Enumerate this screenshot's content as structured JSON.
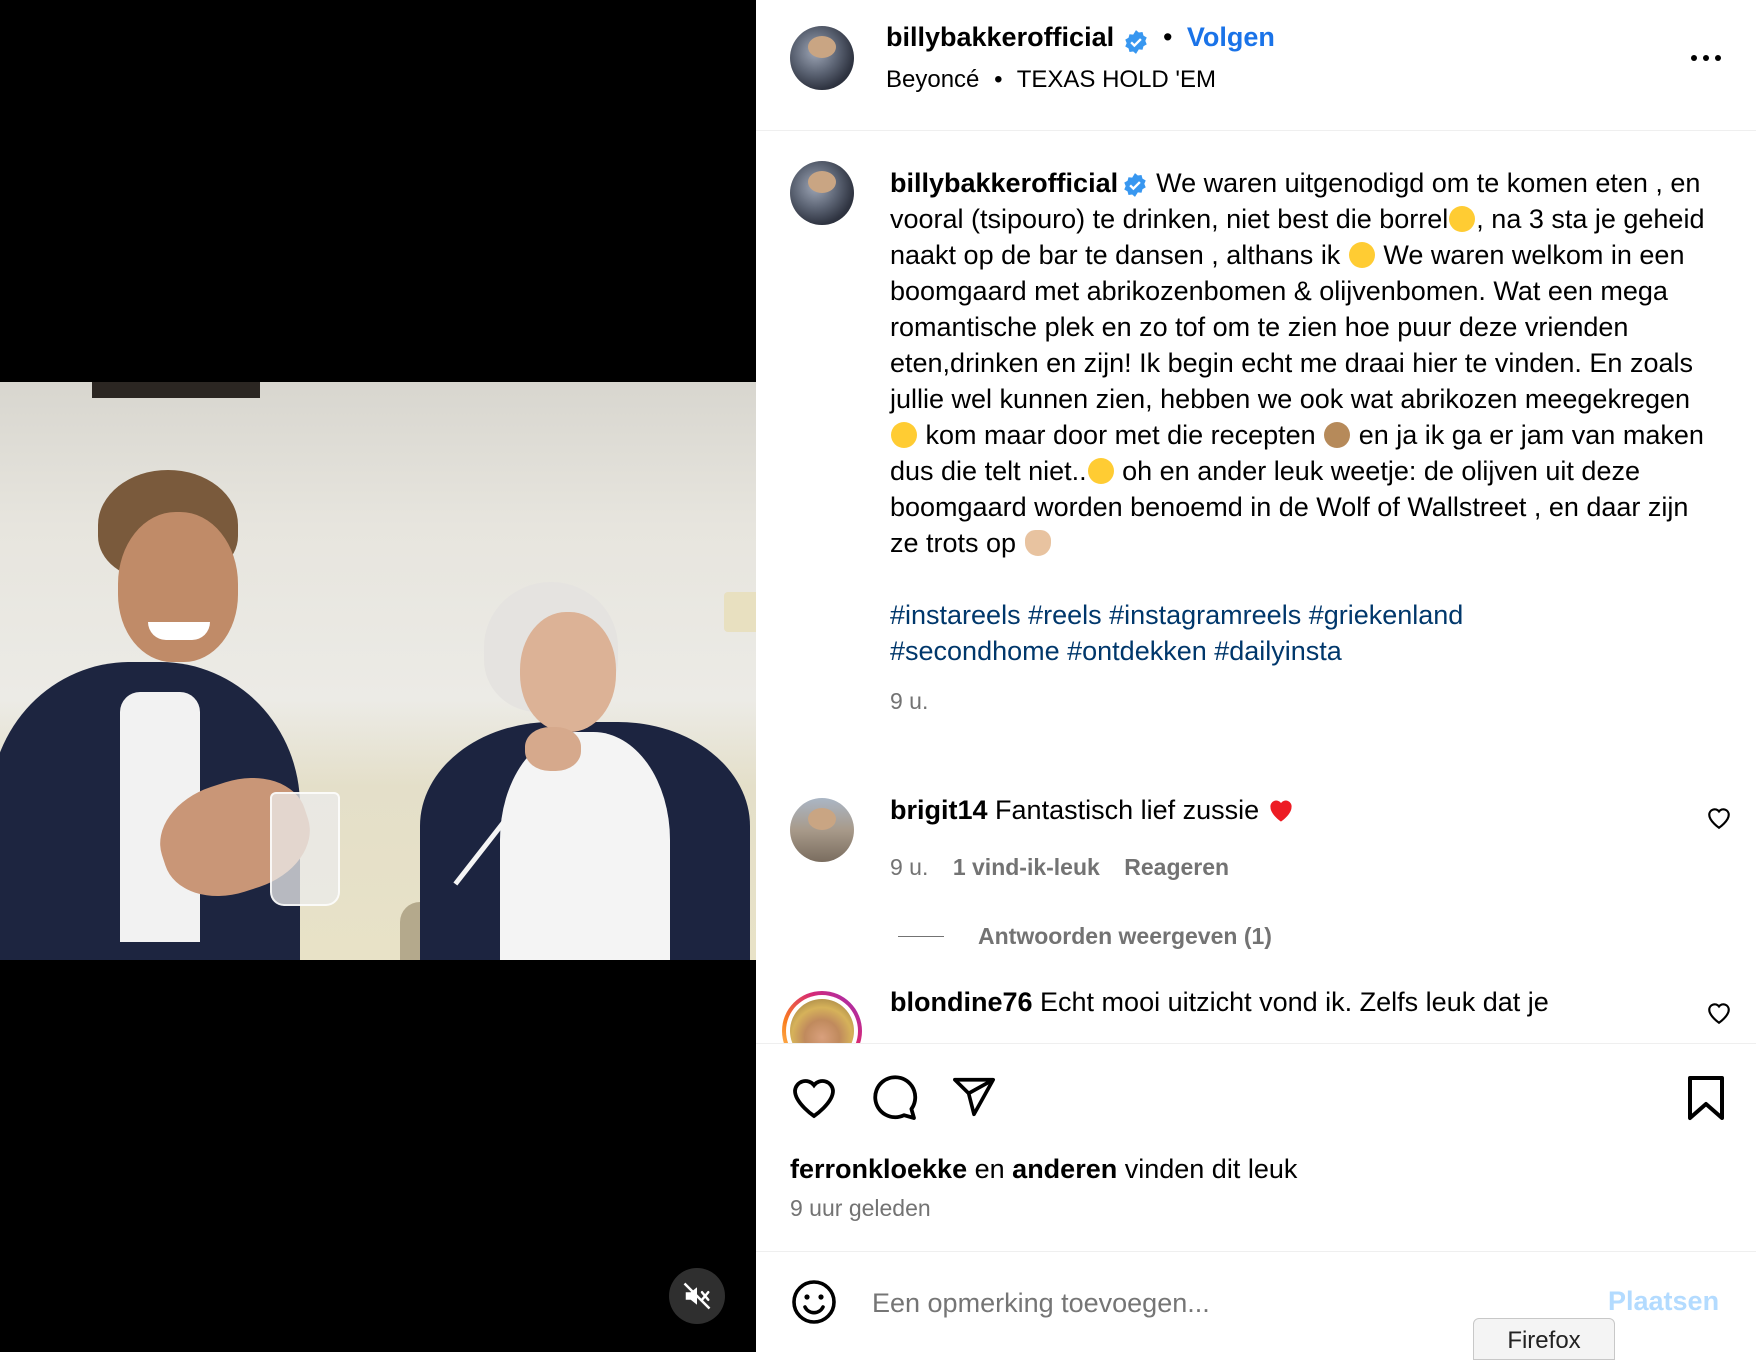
{
  "post": {
    "username": "billybakkerofficial",
    "follow_label": "Volgen",
    "audio_artist": "Beyoncé",
    "audio_title": "TEXAS HOLD 'EM",
    "more_icon": "more-horizontal-icon"
  },
  "caption": {
    "username": "billybakkerofficial",
    "p1": "We waren uitgenodigd om te komen eten , en vooral (tsipouro) te drinken, niet best die borrel",
    "p2": ", na 3 sta je geheid naakt op de bar te dansen , althans ik ",
    "p3": " We waren welkom in een boomgaard met abrikozenbomen & olijvenbomen. Wat een mega romantische plek en zo tof om te zien hoe puur deze vrienden eten,drinken en zijn! Ik begin echt me draai hier te vinden. En zoals jullie wel kunnen zien, hebben we ook wat abrikozen meegekregen",
    "p4": " kom maar door met die recepten ",
    "p5": " en ja ik ga er jam van maken dus die telt niet..",
    "p6": " oh en ander leuk weetje: de olijven uit deze boomgaard worden benoemd in de Wolf of Wallstreet , en daar zijn ze trots op ",
    "hashtags_line1": "#instareels #reels #instagramreels #griekenland",
    "hashtags_line2": "#secondhome #ontdekken #dailyinsta",
    "time": "9 u."
  },
  "comments": [
    {
      "username": "brigit14",
      "text": "Fantastisch lief zussie",
      "time": "9 u.",
      "likes": "1 vind-ik-leuk",
      "reply_label": "Reageren",
      "view_replies": "Antwoorden weergeven (1)"
    },
    {
      "username": "blondine76",
      "text": "Echt mooi uitzicht vond ik. Zelfs leuk dat je"
    }
  ],
  "likes": {
    "first_user": "ferronkloekke",
    "and": "en",
    "others": "anderen",
    "suffix": "vinden dit leuk",
    "time": "9 uur geleden"
  },
  "add_comment": {
    "placeholder": "Een opmerking toevoegen...",
    "post_label": "Plaatsen"
  },
  "browser_tab": "Firefox",
  "colors": {
    "accent": "#1a73e8",
    "hashtag": "#00376b",
    "muted": "#737373",
    "heart_emoji": "#ed1c24"
  }
}
